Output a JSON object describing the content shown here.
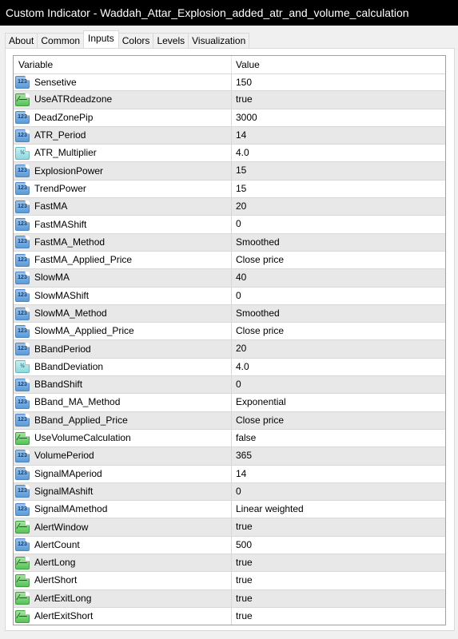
{
  "window": {
    "title": "Custom Indicator - Waddah_Attar_Explosion_added_atr_and_volume_calculation"
  },
  "tabs": [
    {
      "label": "About",
      "active": false
    },
    {
      "label": "Common",
      "active": false
    },
    {
      "label": "Inputs",
      "active": true
    },
    {
      "label": "Colors",
      "active": false
    },
    {
      "label": "Levels",
      "active": false
    },
    {
      "label": "Visualization",
      "active": false
    }
  ],
  "grid": {
    "headers": {
      "variable": "Variable",
      "value": "Value"
    },
    "icon_glyphs": {
      "int": "123",
      "double": "½",
      "bool": "⁄—"
    },
    "rows": [
      {
        "name": "Sensetive",
        "value": "150",
        "type": "int"
      },
      {
        "name": "UseATRdeadzone",
        "value": "true",
        "type": "bool"
      },
      {
        "name": "DeadZonePip",
        "value": "3000",
        "type": "int"
      },
      {
        "name": "ATR_Period",
        "value": "14",
        "type": "int"
      },
      {
        "name": "ATR_Multiplier",
        "value": "4.0",
        "type": "double"
      },
      {
        "name": "ExplosionPower",
        "value": "15",
        "type": "int"
      },
      {
        "name": "TrendPower",
        "value": "15",
        "type": "int"
      },
      {
        "name": "FastMA",
        "value": "20",
        "type": "int"
      },
      {
        "name": "FastMAShift",
        "value": "0",
        "type": "int"
      },
      {
        "name": "FastMA_Method",
        "value": "Smoothed",
        "type": "int"
      },
      {
        "name": "FastMA_Applied_Price",
        "value": "Close price",
        "type": "int"
      },
      {
        "name": "SlowMA",
        "value": "40",
        "type": "int"
      },
      {
        "name": "SlowMAShift",
        "value": "0",
        "type": "int"
      },
      {
        "name": "SlowMA_Method",
        "value": "Smoothed",
        "type": "int"
      },
      {
        "name": "SlowMA_Applied_Price",
        "value": "Close price",
        "type": "int"
      },
      {
        "name": "BBandPeriod",
        "value": "20",
        "type": "int"
      },
      {
        "name": "BBandDeviation",
        "value": "4.0",
        "type": "double"
      },
      {
        "name": "BBandShift",
        "value": "0",
        "type": "int"
      },
      {
        "name": "BBand_MA_Method",
        "value": "Exponential",
        "type": "int"
      },
      {
        "name": "BBand_Applied_Price",
        "value": "Close price",
        "type": "int"
      },
      {
        "name": "UseVolumeCalculation",
        "value": "false",
        "type": "bool"
      },
      {
        "name": "VolumePeriod",
        "value": "365",
        "type": "int"
      },
      {
        "name": "SignalMAperiod",
        "value": "14",
        "type": "int"
      },
      {
        "name": "SignalMAshift",
        "value": "0",
        "type": "int"
      },
      {
        "name": "SignalMAmethod",
        "value": "Linear weighted",
        "type": "int"
      },
      {
        "name": "AlertWindow",
        "value": "true",
        "type": "bool"
      },
      {
        "name": "AlertCount",
        "value": "500",
        "type": "int"
      },
      {
        "name": "AlertLong",
        "value": "true",
        "type": "bool"
      },
      {
        "name": "AlertShort",
        "value": "true",
        "type": "bool"
      },
      {
        "name": "AlertExitLong",
        "value": "true",
        "type": "bool"
      },
      {
        "name": "AlertExitShort",
        "value": "true",
        "type": "bool"
      }
    ]
  }
}
